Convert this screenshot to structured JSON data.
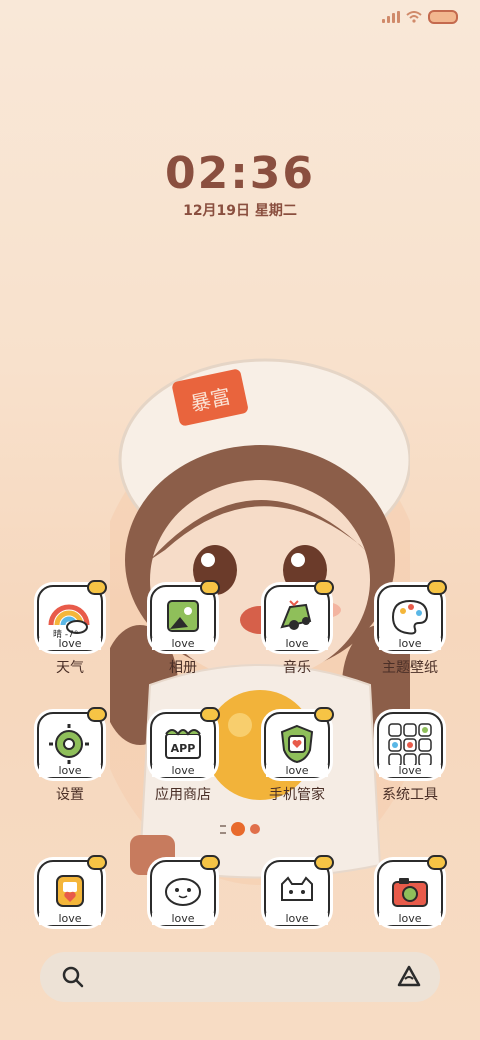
{
  "status_bar": {
    "icons": [
      "signal-icon",
      "wifi-icon",
      "battery-icon"
    ],
    "accent": "#c46a4e"
  },
  "lock": {
    "time": "02:36",
    "date": "12月19日  星期二"
  },
  "apps_row1": [
    {
      "name": "天气",
      "icon": "weather-icon",
      "sub": "晴 -7°"
    },
    {
      "name": "相册",
      "icon": "gallery-icon"
    },
    {
      "name": "音乐",
      "icon": "music-icon"
    },
    {
      "name": "主题壁纸",
      "icon": "themes-icon"
    }
  ],
  "apps_row2": [
    {
      "name": "设置",
      "icon": "settings-icon"
    },
    {
      "name": "应用商店",
      "icon": "app-store-icon"
    },
    {
      "name": "手机管家",
      "icon": "security-icon"
    },
    {
      "name": "系统工具",
      "icon": "system-tools-folder-icon"
    }
  ],
  "dock": [
    {
      "icon": "phone-icon"
    },
    {
      "icon": "messages-icon"
    },
    {
      "icon": "browser-icon"
    },
    {
      "icon": "camera-icon"
    }
  ],
  "love_label": "love",
  "app_store_text": "APP",
  "wallpaper_hat_text": "暴富",
  "search_bar": {
    "icons": [
      "search-icon",
      "assistant-icon"
    ]
  }
}
